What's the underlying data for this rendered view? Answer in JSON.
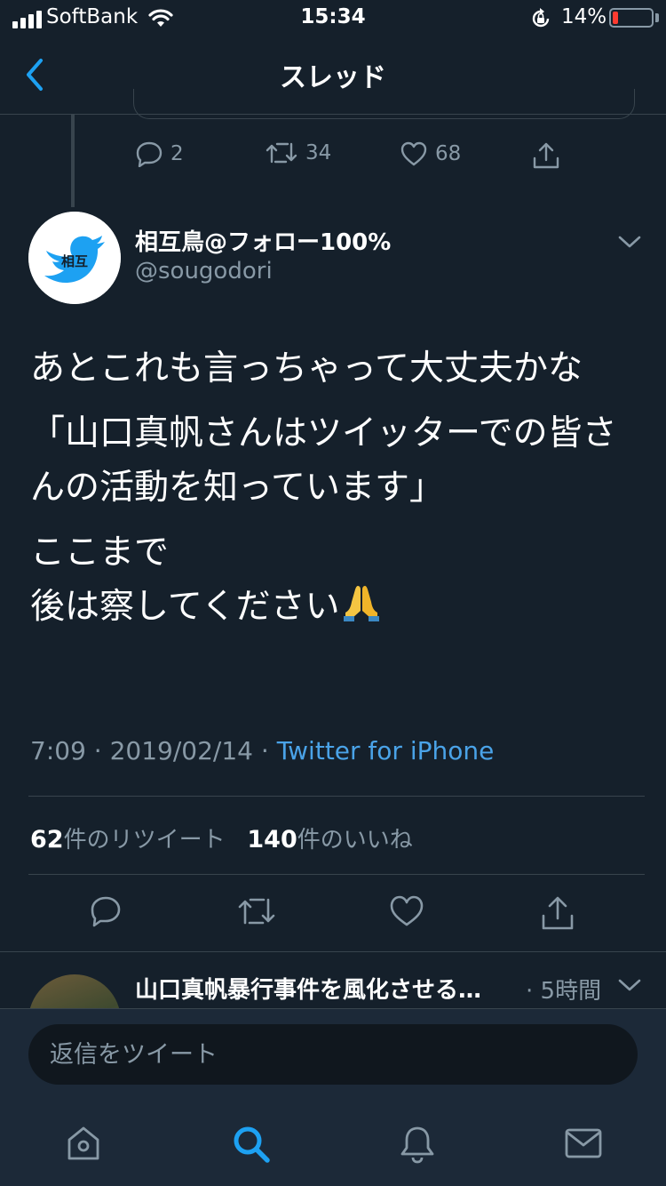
{
  "status_bar": {
    "carrier": "SoftBank",
    "time": "15:34",
    "battery_percent": "14%",
    "battery_level": 0.14,
    "battery_color": "#ff3b30"
  },
  "nav": {
    "title": "スレッド",
    "back_icon": "chevron-left-icon"
  },
  "previous_tweet": {
    "replies": "2",
    "retweets": "34",
    "likes": "68"
  },
  "tweet": {
    "display_name": "相互鳥@フォロー100%",
    "handle": "@sougodori",
    "avatar_text": "相互",
    "body": [
      "あとこれも言っちゃって大丈夫かな",
      "「山口真帆さんはツイッターでの皆さんの活動を知っています」",
      "ここまで\n後は察してください"
    ],
    "emoji": "folded-hands",
    "time": "7:09",
    "date": "2019/02/14",
    "client": "Twitter for iPhone",
    "retweet_count": "62",
    "retweet_label": "件のリツイート",
    "like_count": "140",
    "like_label": "件のいいね"
  },
  "reply_preview": {
    "name": "山口真帆暴行事件を風化させる…",
    "time": "· 5時間"
  },
  "composer": {
    "placeholder": "返信をツイート"
  },
  "tabs": [
    "home-icon",
    "search-icon",
    "notifications-icon",
    "messages-icon"
  ],
  "colors": {
    "background": "#15202b",
    "accent": "#1da1f2",
    "secondary_text": "#8899a6",
    "divider": "#38444d"
  }
}
